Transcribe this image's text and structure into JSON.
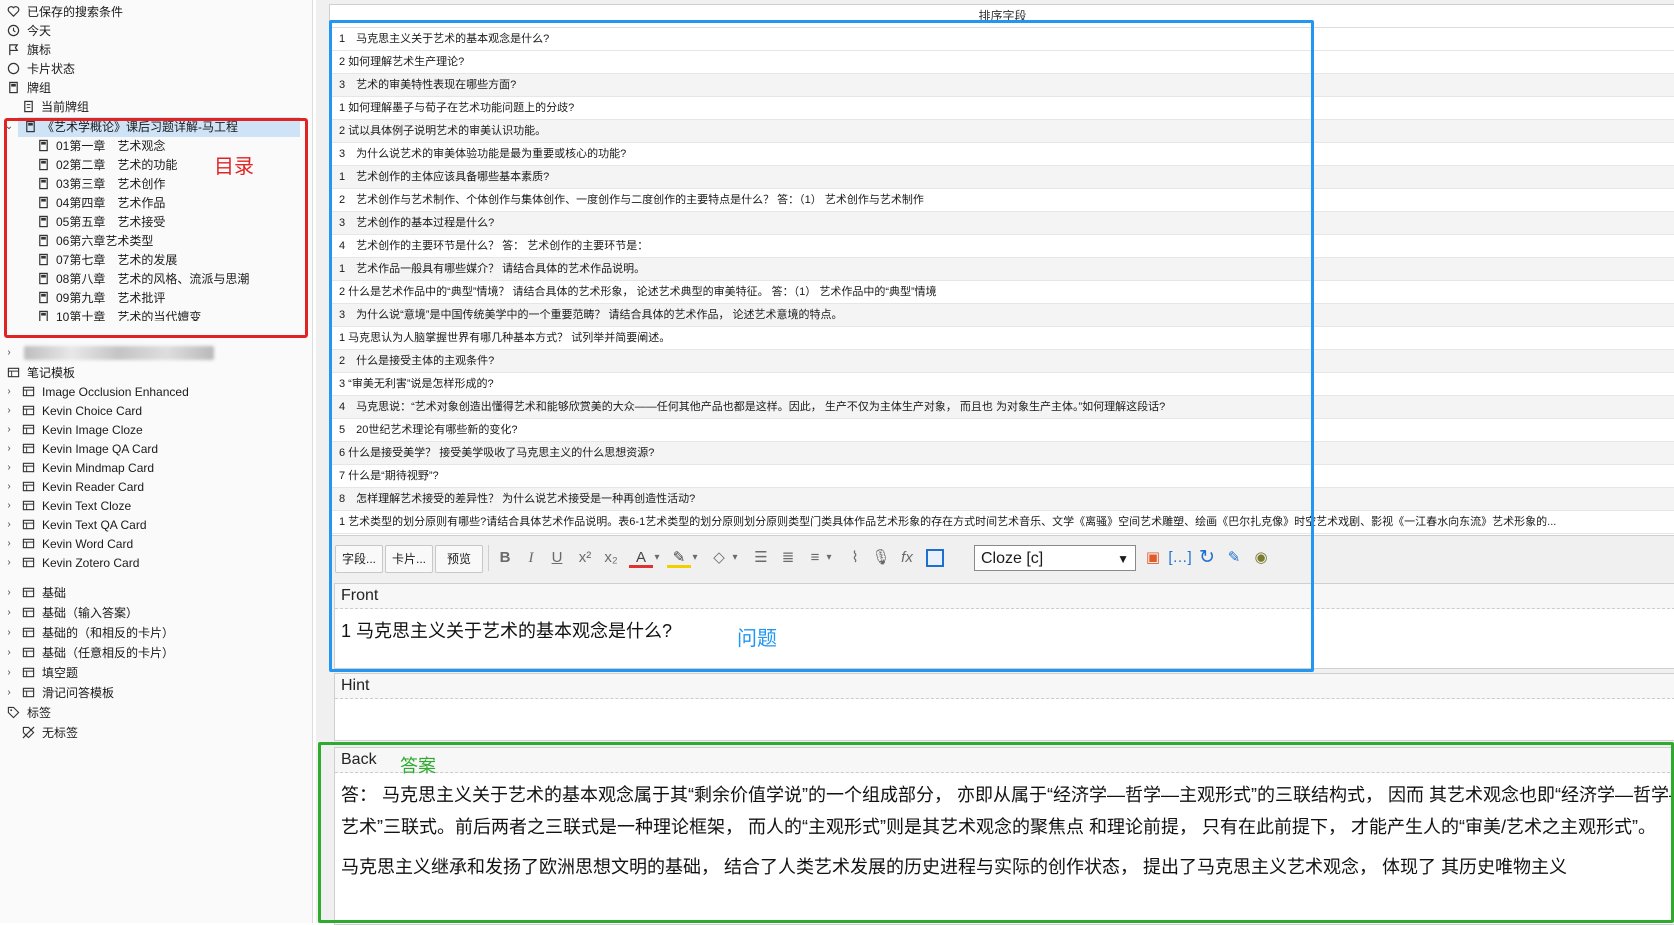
{
  "sidebar": {
    "saved_searches": "已保存的搜索条件",
    "today": "今天",
    "flags": "旗标",
    "card_state": "卡片状态",
    "decks": "牌组",
    "current_deck": "当前牌组",
    "selected_deck": "《艺术学概论》课后习题详解-马工程",
    "chapters": [
      "01第一章　艺术观念",
      "02第二章　艺术的功能",
      "03第三章　艺术创作",
      "04第四章　艺术作品",
      "05第五章　艺术接受",
      "06第六章艺术类型",
      "07第七章　艺术的发展",
      "08第八章　艺术的风格、流派与思潮",
      "09第九章　艺术批评",
      "10第十章　艺术的当代嬗变"
    ],
    "note_types_header": "笔记模板",
    "note_types": [
      "Image Occlusion Enhanced",
      "Kevin Choice Card",
      "Kevin Image Cloze",
      "Kevin Image QA Card",
      "Kevin Mindmap Card",
      "Kevin Reader Card",
      "Kevin Text Cloze",
      "Kevin Text QA Card",
      "Kevin Word Card",
      "Kevin Zotero Card",
      "基础",
      "基础（输入答案）",
      "基础的（和相反的卡片）",
      "基础（任意相反的卡片）",
      "填空题",
      "滑记问答模板"
    ],
    "tags_header": "标签",
    "no_tags": "无标签",
    "annotation": "目录"
  },
  "table": {
    "header": "排序字段",
    "rows": [
      "1　马克思主义关于艺术的基本观念是什么?",
      "2 如何理解艺术生产理论?",
      "3　艺术的审美特性表现在哪些方面?",
      "1 如何理解墨子与荀子在艺术功能问题上的分歧?",
      "2 试以具体例子说明艺术的审美认识功能。",
      "3　为什么说艺术的审美体验功能是最为重要或核心的功能?",
      "1　艺术创作的主体应该具备哪些基本素质?",
      "2　艺术创作与艺术制作、个体创作与集体创作、一度创作与二度创作的主要特点是什么？ 答：（1） 艺术创作与艺术制作",
      "3　艺术创作的基本过程是什么?",
      "4　艺术创作的主要环节是什么？ 答： 艺术创作的主要环节是：",
      "1　艺术作品一般具有哪些媒介？ 请结合具体的艺术作品说明。",
      "2 什么是艺术作品中的“典型”情境？ 请结合具体的艺术形象， 论述艺术典型的审美特征。 答：（1） 艺术作品中的“典型”情境",
      "3　为什么说“意境”是中国传统美学中的一个重要范畴？ 请结合具体的艺术作品， 论述艺术意境的特点。",
      "1 马克思认为人脑掌握世界有哪几种基本方式？ 试列举并简要阐述。",
      "2　什么是接受主体的主观条件?",
      "3 “审美无利害”说是怎样形成的?",
      "4　马克思说：“艺术对象创造出懂得艺术和能够欣赏美的大众——任何其他产品也都是这样。因此， 生产不仅为主体生产对象， 而且也 为对象生产主体。”如何理解这段话?",
      "5　20世纪艺术理论有哪些新的变化?",
      "6 什么是接受美学？ 接受美学吸收了马克思主义的什么思想资源?",
      "7 什么是“期待视野”?",
      "8　怎样理解艺术接受的差异性？ 为什么说艺术接受是一种再创造性活动?",
      "1 艺术类型的划分原则有哪些?请结合具体艺术作品说明。表6-1艺术类型的划分原则划分原则类型门类具体作品艺术形象的存在方式时间艺术音乐、文学《离骚》空间艺术雕塑、绘画《巴尔扎克像》时空艺术戏剧、影视《一江春水向东流》艺术形象的..."
    ]
  },
  "editor": {
    "fields_btn": "字段...",
    "cards_btn": "卡片...",
    "preview_btn": "预览",
    "note_type_select": "Cloze [c]",
    "front_label": "Front",
    "front_value": "1 马克思主义关于艺术的基本观念是什么?",
    "question_annotation": "问题",
    "hint_label": "Hint",
    "hint_value": "",
    "back_label": "Back",
    "answer_annotation": "答案",
    "back_p1": "答： 马克思主义关于艺术的基本观念属于其“剩余价值学说”的一个组成部分， 亦即从属于“经济学—哲学—主观形式”的三联结构式， 因而 其艺术观念也即“经济学—哲学—艺术”三联式。前后两者之三联式是一种理论框架， 而人的“主观形式”则是其艺术观念的聚焦点 和理论前提， 只有在此前提下， 才能产生人的“审美/艺术之主观形式”。",
    "back_p2": "马克思主义继承和发扬了欧洲思想文明的基础， 结合了人类艺术发展的历史进程与实际的创作状态， 提出了马克思主义艺术观念， 体现了 其历史唯物主义"
  }
}
